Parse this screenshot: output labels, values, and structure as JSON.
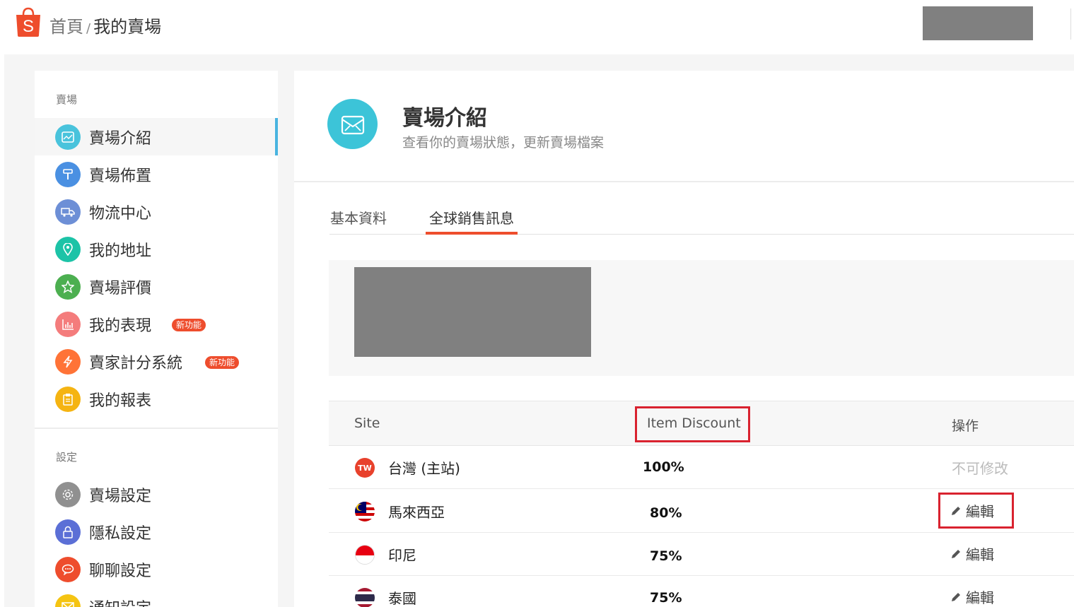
{
  "header": {
    "breadcrumb_home": "首頁",
    "breadcrumb_sep": "/",
    "breadcrumb_current": "我的賣場",
    "brand_color": "#ee4d2d"
  },
  "sidebar": {
    "section1_title": "賣場",
    "items": [
      {
        "label": "賣場介紹",
        "icon": "shop-intro-icon",
        "color": "#49c3dc",
        "active": true
      },
      {
        "label": "賣場佈置",
        "icon": "paint-roller-icon",
        "color": "#4a90e2"
      },
      {
        "label": "物流中心",
        "icon": "truck-icon",
        "color": "#6d8fd6"
      },
      {
        "label": "我的地址",
        "icon": "location-pin-icon",
        "color": "#1cc3a7"
      },
      {
        "label": "賣場評價",
        "icon": "star-icon",
        "color": "#4caf50"
      },
      {
        "label": "我的表現",
        "icon": "bar-chart-icon",
        "color": "#f47c7c",
        "badge": "新功能"
      },
      {
        "label": "賣家計分系統",
        "icon": "lightning-icon",
        "color": "#ff7337",
        "badge": "新功能"
      },
      {
        "label": "我的報表",
        "icon": "clipboard-icon",
        "color": "#f5b412"
      }
    ],
    "section2_title": "設定",
    "settings_items": [
      {
        "label": "賣場設定",
        "icon": "gear-icon",
        "color": "#909090"
      },
      {
        "label": "隱私設定",
        "icon": "lock-icon",
        "color": "#5b6fd6"
      },
      {
        "label": "聊聊設定",
        "icon": "chat-bubble-icon",
        "color": "#ee4d2d"
      },
      {
        "label": "通知設定",
        "icon": "envelope-icon",
        "color": "#f5c412"
      }
    ]
  },
  "main": {
    "title": "賣場介紹",
    "subtitle": "查看你的賣場狀態，更新賣場檔案",
    "tabs": [
      {
        "label": "基本資料",
        "active": false
      },
      {
        "label": "全球銷售訊息",
        "active": true
      }
    ],
    "table": {
      "headers": {
        "site": "Site",
        "discount": "Item Discount",
        "action": "操作"
      },
      "rows": [
        {
          "flag": "taiwan-flag-icon",
          "flag_text": "TW",
          "site": "台灣 (主站)",
          "discount": "100%",
          "action": "不可修改",
          "editable": false
        },
        {
          "flag": "malaysia-flag-icon",
          "site": "馬來西亞",
          "discount": "80%",
          "action": "編輯",
          "editable": true
        },
        {
          "flag": "indonesia-flag-icon",
          "site": "印尼",
          "discount": "75%",
          "action": "編輯",
          "editable": true
        },
        {
          "flag": "thailand-flag-icon",
          "site": "泰國",
          "discount": "75%",
          "action": "編輯",
          "editable": true
        }
      ]
    }
  }
}
